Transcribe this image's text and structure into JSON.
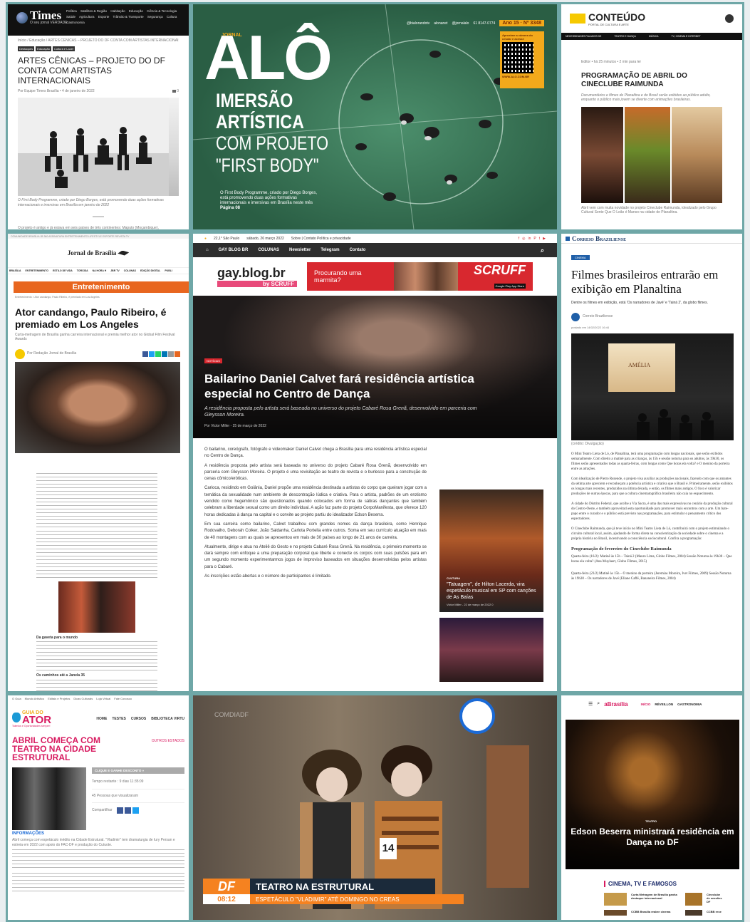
{
  "times": {
    "logo": "Times",
    "logo_sub": "Brasília",
    "tagline": "O seu jornal VERDADE",
    "nav": [
      "Política",
      "Satélites & Região",
      "Habitação",
      "Educação",
      "Ciência & Tecnologia",
      "Saúde",
      "Agricultura",
      "Esporte",
      "Trânsito & Transporte",
      "Segurança",
      "Cultura",
      "Mu",
      "Gastronomia"
    ],
    "crumbs": "Início  /  Educação  /  ARTES CÊNICAS – PROJETO DO DF CONTA COM ARTISTAS INTERNACIONAIS",
    "tags": [
      "Destaques",
      "Educação",
      "Cultura e Lazer"
    ],
    "title": "ARTES CÊNICAS – PROJETO DO DF CONTA COM ARTISTAS INTERNACIONAIS",
    "byline": "Por Equipe Times Brasília  •  4 de janeiro de 2022",
    "comments": "0",
    "caption": "O First Body Programme, criado por Diego Borges, está promovendo duas ações formativas internacionais e imersivas em Brasília em janeiro de 2022",
    "foot": "O projeto é antigo e já estava em seis países de três continentes: Maputo (Moçambique),"
  },
  "alo": {
    "top_links": [
      "@bialorandotv",
      "alonanet",
      "@jornalalo",
      "61 8147-0774"
    ],
    "edition": "Ano 15 · Nº 3348",
    "jornal": "JORNAL",
    "logo": "ALÔ",
    "qr_text": "Aproxime a câmera do celular e acesse",
    "site": "WWW.ALO.COM.BR",
    "h1": "IMERSÃO",
    "h2": "ARTÍSTICA",
    "h3": "COM PROJETO",
    "h4": "\"FIRST BODY\"",
    "teaser": "O First Body Programme, criado por Diego Borges, está promovendo duas ações formativas internacionais e imersivas em Brasília neste mês",
    "page": "Página 08"
  },
  "conteudo": {
    "brand": "CONTEÚDO",
    "brand_sub": "PORTAL DE CULTURA E ARTE",
    "nav": [
      "NECESSIDADES FALADOS DE",
      "TEATRO E DANÇA",
      "MÚSICA",
      "TV, CINEMA E INTERNET"
    ],
    "meta": "Editor  •  há 25 minutos  •  2 min para ler",
    "title": "PROGRAMAÇÃO DE ABRIL DO CINECLUBE RAIMUNDA",
    "lead": "Documentários e filmes de Planaltina e do Brasil serão exibidos ao público adulto, enquanto o público mais jovem se diverte com animações brasileiras.",
    "caption": "Abril vem com muita novidade no projeto Cineclube Raimunda, idealizado pelo Grupo Cultural Sente Que O Leão é Manso na cidade de Planaltina."
  },
  "jornal": {
    "logo": "Jornal de Brasília",
    "nav": [
      "BRASÍLIA",
      "ENTRETENIMENTO",
      "ESTILO DE VIDA",
      "TORCIDA",
      "NA HORA H",
      "JBR TV",
      "COLUNAS",
      "EDIÇÃO DIGITAL",
      "PUBLI"
    ],
    "section": "Entretenimento",
    "crumbs": "Entretenimento  >  Ator candango, Paulo Ribeiro, é premiado em Los Angeles",
    "title": "Ator candango, Paulo Ribeiro, é premiado em Los Angeles",
    "sub": "Curta-metragem de Brasília ganha carreira internacional e premia melhor ator no Global Film Festival Awards",
    "byline": "Por Redação Jornal de Brasília",
    "h_a": "Da gaveta para o mundo",
    "h_b": "Os caminhos até a Janela 35"
  },
  "gay": {
    "weather": "22,1°  São Paulo",
    "date": "sábado, 26 março 2022",
    "links": "Sobre  |  Contato    Política e privacidade",
    "nav": [
      "GAY BLOG BR",
      "COLUNAS",
      "Newsletter",
      "Telegram",
      "Contato"
    ],
    "logo": "gay.blog.br",
    "logo_sub": "by SCRUFF",
    "ad_text": "Procurando uma marmita?",
    "ad_brand": "SCRUFF",
    "ad_store": "Google Play   App Store",
    "tag": "NOTÍCIAS",
    "title": "Bailarino Daniel Calvet fará residência artística especial no Centro de Dança",
    "lead": "A residência proposta pelo artista será baseada no universo do projeto Cabaré Rosa Grenã, desenvolvido em parceria com Gleysson Moreira.",
    "byline": "Por Victor Miller  -  25 de março de 2022",
    "paragraphs": [
      "O bailarino, coreógrafo, fotógrafo e videomaker Daniel Calvet chega a Brasília para uma residência artística especial no Centro de Dança.",
      "A residência proposta pelo artista será baseada no universo do projeto Cabaré Rosa Grenã, desenvolvido em parceria com Gleysson Moreira. O projeto é uma revisitação ao teatro de revista e o burlesco para a construção de cenas cômico/eróticas.",
      "Carioca, residindo em Goiânia, Daniel propõe uma residência destinada a artistas do corpo que queiram jogar com a temática da sexualidade num ambiente de descontração lúdica e criativa. Para o artista, padrões de um erotismo vendido como hegemônico são questionados quando colocados em forma de sátiras dançantes que também celebram a liberdade sexual como um direito individual. A ação faz parte do projeto CorpoManifesta, que oferece 120 horas dedicadas à dança na capital e o convite ao projeto partiu do idealizador Edson Beserra.",
      "Em sua carreira como bailarino, Calvet trabalhou com grandes nomes da dança brasileira, como Henrique Rodovalho, Deborah Colker, João Saldanha, Carlota Portella entre outros. Soma em seu currículo atuação em mais de 40 montagens com as quais se apresentou em mais de 30 países ao longo de 21 anos de carreira.",
      "Atualmente, dirige e atua no Ateliê do Gesto e no projeto Cabaré Rosa Grenã. Na residência, o primeiro momento se dará sempre com enfoque a uma preparação corporal que liberte e conecte os corpos com suas pulsões para em um segundo momento experimentarmos jogos de improviso baseados em situações desenvolvidas pelos artistas para o Cabaré.",
      "As inscrições estão abertas e o número de participantes é limitado."
    ],
    "side_tag": "CULTURA",
    "side_title": "\"Tatuagem\", de Hilton Lacerda, vira espetáculo musical em SP com canções de As Baías",
    "side_meta": "Victor Miller  -  22 de março de 2022   0"
  },
  "correio": {
    "logo": "Correio Braziliense",
    "tag": "CINEMA",
    "title": "Filmes brasileiros entrarão em exibição em Planaltina",
    "sub": "Dentre os filmes em exibição, está 'Os narradores de Javé' e 'Tainá 2', da globo filmes.",
    "author": "Correio Braziliense",
    "date": "postado em 14/02/2022 16:44",
    "screen_text": "AMÉLIA",
    "credit": "(crédito: Divulgação)",
    "p1": "O Mini Teatro Lieta de Ló, de Planaltina, terá uma programação com longas nacionais, que serão exibidos semanalmente. Com direito a matinê para as crianças, às 15h e sessão noturna para os adultos, às 19h30, os filmes serão apresentados todas as quarta-feiras, com longas como Que horas ela volta? e O menino da porteira entre as atrações.",
    "p2": "Com idealização de Pietro Rezende, o projeto visa auxiliar as produções nacionais, fazendo com que os amantes da sétima arte apreciem e reconheçam a potência artística e criativa que o Brasil é. Primeiramente, serão exibidos os longas mais recentes, produzidos na última década, e então, os filmes mais antigos. O foco é valorizar produções de outras épocas, para que a cultura cinematográfica brasileira não caia no esquecimento.",
    "p3": "A cidade do Distrito Federal, que acolhe a Via Sacra, é uma das mais expressivas no cenário da produção cultural do Centro-Oeste, e também aproveitará esta oportunidade para promover mais encontros com a arte. Um bate-papo entre o curador e o público está previsto nas programações, para estimular o pensamento crítico dos espectadores.",
    "p4": "O Cineclube Raimunda, que já teve início no Mini Teatro Lieta de Ló, contribuirá com o projeto estimulando o circuito cultural local, assim, ajudando de forma direta na conscientização da sociedade sobre o cinema e a própria história no Brasil, incentivando a consciência sociocultural. Confira a programação:",
    "h2": "Programação de fevereiro do Cineclube Raimunda",
    "l1": "Quarta-feira (16/2): Matinê às 15h – Tainá 2 (Mauro Lima, Globo Filmes, 2004) Sessão Noturna às 19h30 – Que horas ela volta? (Ana Muylaert, Globo Filmes, 2015)",
    "l2": "Quarta-feira (23/2) Matinê às 15h – O menino da porteira (Jeremias Moreira, Ivet Filmes, 2009) Sessão Noturna às 19h30 – Os narradores de Javé (Eliane Caffé, Bananeira Filmes, 2004)"
  },
  "guia": {
    "top": [
      "O Guia",
      "Mundo Artístico",
      "Editais e Projetos",
      "Dicas Culturais",
      "Loja Virtual",
      "Fale Conosco"
    ],
    "logo_a": "GUIA DO",
    "logo_b": "ATOR",
    "logo_sub": "Talentos e Oportunidades sempre!",
    "nav": [
      "HOME",
      "TESTES",
      "CURSOS",
      "BIBLIOTECA VIRTU"
    ],
    "title": "ABRIL COMEÇA COM TEATRO NA CIDADE ESTRUTURAL",
    "outros": "OUTROS ESTADOS",
    "cta": "CLIQUE E GANHE DESCONTO  »",
    "timer": "Tempo restante : 9 dias 11:35:09",
    "viewers": "45 Pessoas que visualizaram",
    "share": "Compartilhar",
    "info": "INFORMAÇÕES",
    "p": "Abril começa com espetáculo inédito na Cidade Estrutural. \"Vladimir\" tem dramaturgia de Iury Persan e estreia em 2022 com apoio do FAC-DF e produção do Cuíuote."
  },
  "df": {
    "watermark": "COMDIADF",
    "badge": "DF",
    "time": "08:12",
    "headline": "TEATRO NA ESTRUTURAL",
    "sub": "ESPETÁCULO \"VLADIMIR\" ATÉ DOMINGO NO CREAS",
    "tag": "14"
  },
  "abrasilia": {
    "logo": "aBrasília",
    "nav": [
      "INÍCIO",
      "RÉVEILLON",
      "GASTRONOMIA"
    ],
    "tag": "TEATRO",
    "title": "Edson Beserra ministrará residência em Dança no DF",
    "section": "CINEMA, TV E FAMOSOS",
    "items": [
      "Curta Metragem de Brasília ganha destaque internacional",
      "CCBB Brasília reabre cinema"
    ],
    "items_b": [
      "Cineclube de sessões DF",
      "CCBB rece"
    ]
  },
  "colors": {
    "frame": "#6fa7a7",
    "jornal_orange": "#e8661f",
    "alo_green": "#2f6f52",
    "gay_red": "#d8282f",
    "guia_pink": "#d81b60",
    "df_orange": "#f58220",
    "correio_blue": "#1f5fa8"
  }
}
